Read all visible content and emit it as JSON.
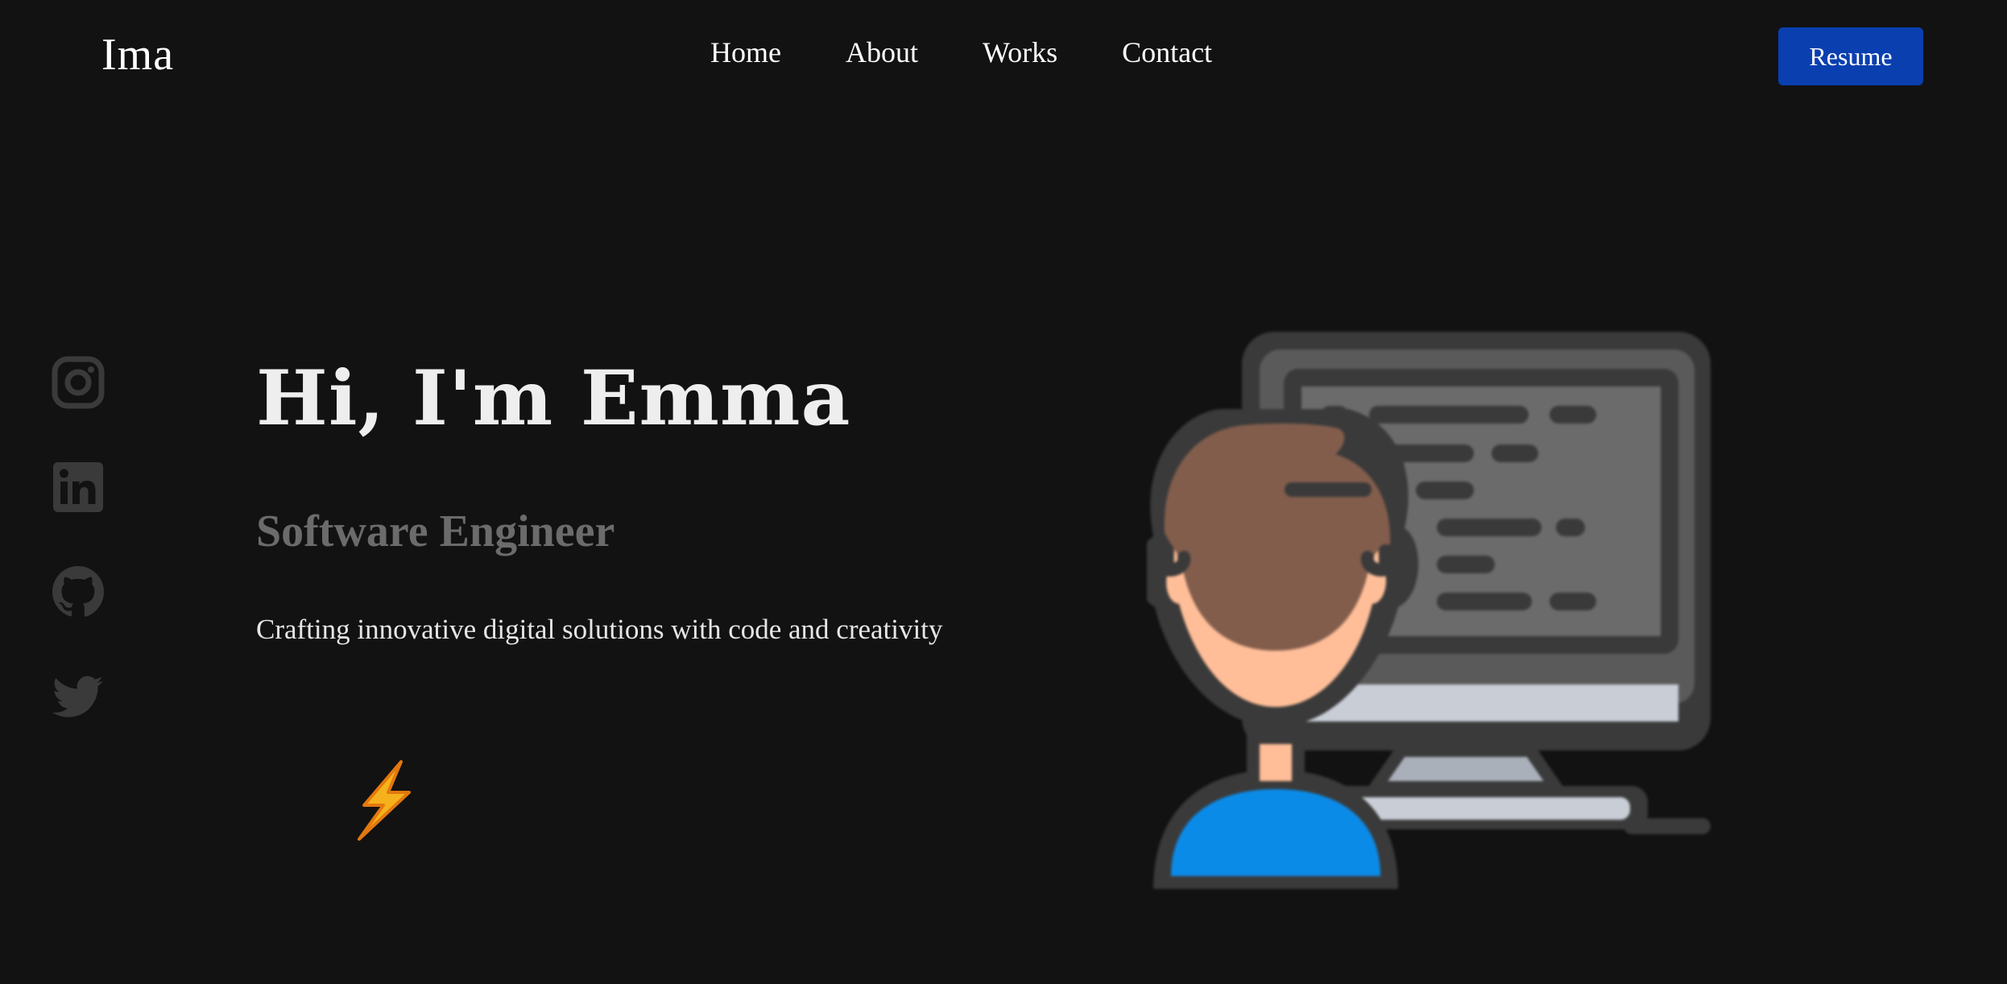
{
  "header": {
    "logo": "Ima",
    "nav": [
      {
        "label": "Home"
      },
      {
        "label": "About"
      },
      {
        "label": "Works"
      },
      {
        "label": "Contact"
      }
    ],
    "resume_label": "Resume"
  },
  "social": [
    {
      "icon": "instagram-icon"
    },
    {
      "icon": "linkedin-icon"
    },
    {
      "icon": "github-icon"
    },
    {
      "icon": "twitter-icon"
    }
  ],
  "hero": {
    "title": "Hi, I'm Emma",
    "role": "Software Engineer",
    "tagline": "Crafting innovative digital solutions with code and creativity",
    "decor_icon": "lightning-bolt-icon",
    "illustration": "developer-at-computer-illustration"
  },
  "colors": {
    "background": "#121212",
    "accent": "#0a3fb0",
    "muted": "#6b6b6b",
    "icon": "#3a3a3a"
  }
}
